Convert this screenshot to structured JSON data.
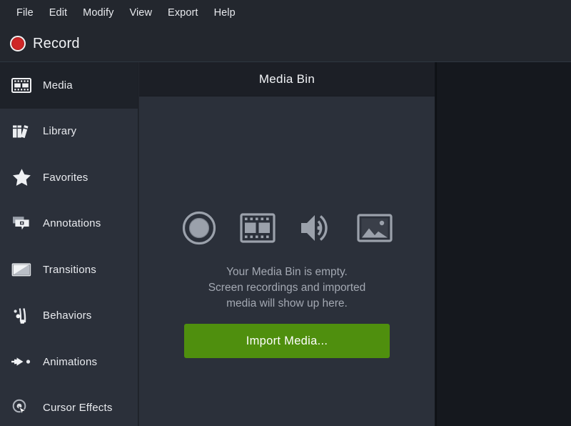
{
  "app": {
    "accent_green": "#4f8f0e",
    "record_red": "#cf2626",
    "bg_dark": "#23272e",
    "bg_panel": "#2b303a",
    "bg_selected": "#1e2229",
    "bg_right": "#15181e"
  },
  "menubar": {
    "items": [
      {
        "label": "File",
        "name": "menu-file"
      },
      {
        "label": "Edit",
        "name": "menu-edit"
      },
      {
        "label": "Modify",
        "name": "menu-modify"
      },
      {
        "label": "View",
        "name": "menu-view"
      },
      {
        "label": "Export",
        "name": "menu-export"
      },
      {
        "label": "Help",
        "name": "menu-help"
      }
    ]
  },
  "toolbar": {
    "record_label": "Record",
    "record_icon": "record-circle-icon"
  },
  "sidebar": {
    "items": [
      {
        "label": "Media",
        "icon": "film-strip-icon",
        "selected": true
      },
      {
        "label": "Library",
        "icon": "books-icon",
        "selected": false
      },
      {
        "label": "Favorites",
        "icon": "star-icon",
        "selected": false
      },
      {
        "label": "Annotations",
        "icon": "speech-bubble-icon",
        "selected": false
      },
      {
        "label": "Transitions",
        "icon": "transition-icon",
        "selected": false
      },
      {
        "label": "Behaviors",
        "icon": "behaviors-icon",
        "selected": false
      },
      {
        "label": "Animations",
        "icon": "arrow-animate-icon",
        "selected": false
      },
      {
        "label": "Cursor Effects",
        "icon": "cursor-ring-icon",
        "selected": false
      }
    ]
  },
  "media_bin": {
    "title": "Media Bin",
    "empty_icons": [
      "record-circle-icon",
      "film-strip-icon",
      "speaker-audio-icon",
      "image-picture-icon"
    ],
    "empty_line1": "Your Media Bin is empty.",
    "empty_line2": "Screen recordings and imported",
    "empty_line3": "media will show up here.",
    "import_label": "Import Media..."
  }
}
